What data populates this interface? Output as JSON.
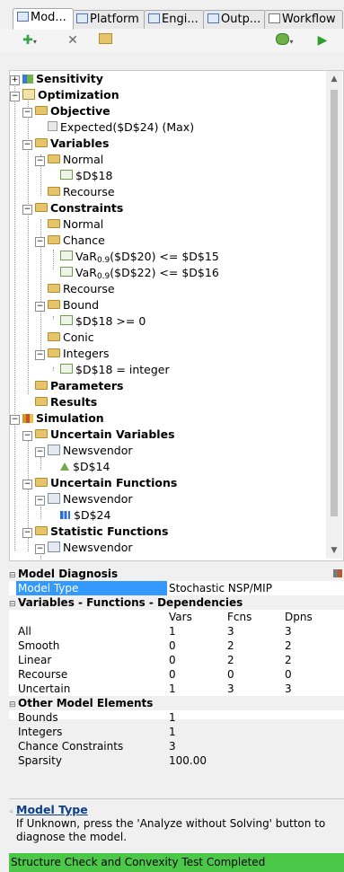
{
  "tabs": [
    {
      "label": "Mod..."
    },
    {
      "label": "Platform"
    },
    {
      "label": "Engi..."
    },
    {
      "label": "Outp..."
    },
    {
      "label": "Workflow"
    }
  ],
  "toolbar": {
    "add_icon": "plus-dropdown-icon",
    "delete_icon": "x-icon",
    "refresh_icon": "folder-refresh-icon",
    "analyze_icon": "analyze-dropdown-icon",
    "run_icon": "play-icon"
  },
  "tree": {
    "sensitivity": "Sensitivity",
    "optimization": "Optimization",
    "objective": "Objective",
    "objective_item": "Expected($D$24) (Max)",
    "variables": "Variables",
    "var_normal": "Normal",
    "var_normal_item": "$D$18",
    "var_recourse": "Recourse",
    "constraints": "Constraints",
    "con_normal": "Normal",
    "con_chance": "Chance",
    "chance1_pre": "VaR",
    "chance1_sub": "0.9",
    "chance1_post": "($D$20) <= $D$15",
    "chance2_pre": "VaR",
    "chance2_sub": "0.9",
    "chance2_post": "($D$22) <= $D$16",
    "con_recourse": "Recourse",
    "con_bound": "Bound",
    "bound_item": "$D$18 >= 0",
    "con_conic": "Conic",
    "con_integers": "Integers",
    "integers_item": "$D$18 = integer",
    "parameters": "Parameters",
    "results": "Results",
    "simulation": "Simulation",
    "uncertain_vars": "Uncertain Variables",
    "uv_newsvendor": "Newsvendor",
    "uv_item": "$D$14",
    "uncertain_funcs": "Uncertain Functions",
    "uf_newsvendor": "Newsvendor",
    "uf_item": "$D$24",
    "statistic_funcs": "Statistic Functions",
    "sf_newsvendor": "Newsvendor"
  },
  "diagnosis": {
    "header": "Model Diagnosis",
    "model_type_label": "Model Type",
    "model_type_value": "Stochastic NSP/MIP"
  },
  "vfd": {
    "header": "Variables - Functions - Dependencies",
    "columns": [
      "Vars",
      "Fcns",
      "Dpns"
    ],
    "rows": [
      {
        "label": "All",
        "vars": "1",
        "fcns": "3",
        "dpns": "3"
      },
      {
        "label": "Smooth",
        "vars": "0",
        "fcns": "2",
        "dpns": "2"
      },
      {
        "label": "Linear",
        "vars": "0",
        "fcns": "2",
        "dpns": "2"
      },
      {
        "label": "Recourse",
        "vars": "0",
        "fcns": "0",
        "dpns": "0"
      },
      {
        "label": "Uncertain",
        "vars": "1",
        "fcns": "3",
        "dpns": "3"
      }
    ]
  },
  "other": {
    "header": "Other Model Elements",
    "rows": [
      {
        "label": "Bounds",
        "value": "1"
      },
      {
        "label": "Integers",
        "value": "1"
      },
      {
        "label": "Chance Constraints",
        "value": "3"
      },
      {
        "label": "Sparsity",
        "value": "100.00"
      }
    ]
  },
  "description": {
    "title": "Model Type",
    "body": "If Unknown, press the 'Analyze without Solving' button to diagnose the model."
  },
  "status": "Structure Check and Convexity Test Completed"
}
